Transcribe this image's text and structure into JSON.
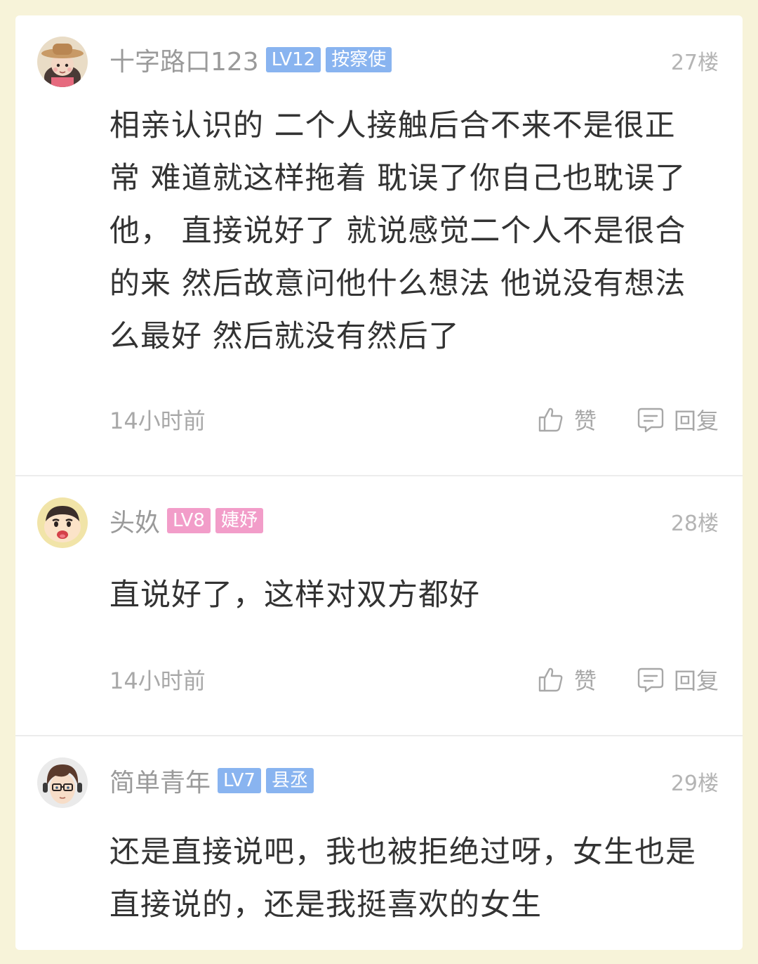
{
  "colors": {
    "page_bg": "#f7f3d9",
    "badge_blue": "#89b4f0",
    "badge_pink": "#f29dc9",
    "text_muted": "#a8a8a8"
  },
  "comments": [
    {
      "username": "十字路口123",
      "level": "LV12",
      "title": "按察使",
      "badge_color": "#89b4f0",
      "floor": "27楼",
      "content": "相亲认识的 二个人接触后合不来不是很正常 难道就这样拖着 耽误了你自己也耽误了他，  直接说好了 就说感觉二个人不是很合的来 然后故意问他什么想法 他说没有想法么最好 然后就没有然后了",
      "time": "14小时前",
      "like_label": "赞",
      "reply_label": "回复",
      "avatar_icon": "cowboy-girl-avatar"
    },
    {
      "username": "头奺",
      "level": "LV8",
      "title": "婕妤",
      "badge_color": "#f29dc9",
      "floor": "28楼",
      "content": "直说好了，这样对双方都好",
      "time": "14小时前",
      "like_label": "赞",
      "reply_label": "回复",
      "avatar_icon": "cartoon-boy-avatar"
    },
    {
      "username": "简单青年",
      "level": "LV7",
      "title": "县丞",
      "badge_color": "#89b4f0",
      "floor": "29楼",
      "content": "还是直接说吧，我也被拒绝过呀，女生也是直接说的，还是我挺喜欢的女生",
      "avatar_icon": "anime-boy-glasses-avatar"
    }
  ]
}
